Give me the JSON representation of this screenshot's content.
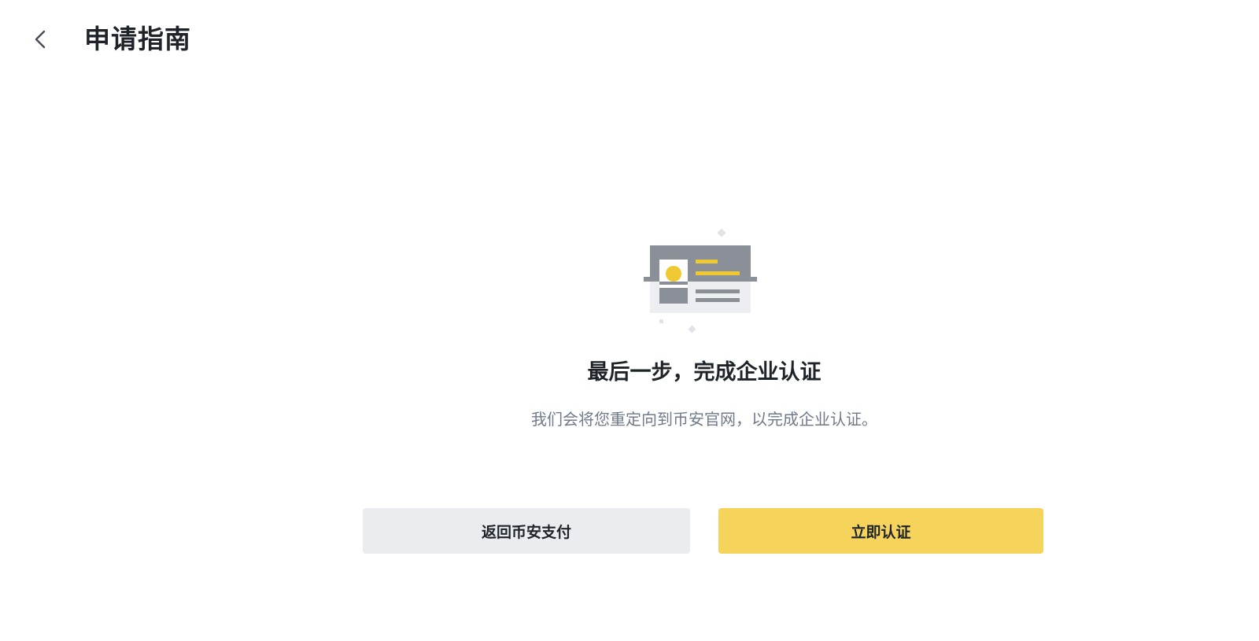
{
  "header": {
    "title": "申请指南",
    "back_icon": "chevron-left-icon"
  },
  "illustration": {
    "icon": "id-card-icon",
    "colors": {
      "gray": "#8a8f98",
      "light": "#eceef1",
      "accent": "#f0c932"
    }
  },
  "main": {
    "heading": "最后一步，完成企业认证",
    "description": "我们会将您重定向到币安官网，以完成企业认证。"
  },
  "actions": {
    "back_label": "返回币安支付",
    "verify_label": "立即认证"
  },
  "colors": {
    "primary": "#f6d45c",
    "secondary": "#eaecef",
    "text": "#1e2329",
    "muted": "#707a8a"
  }
}
